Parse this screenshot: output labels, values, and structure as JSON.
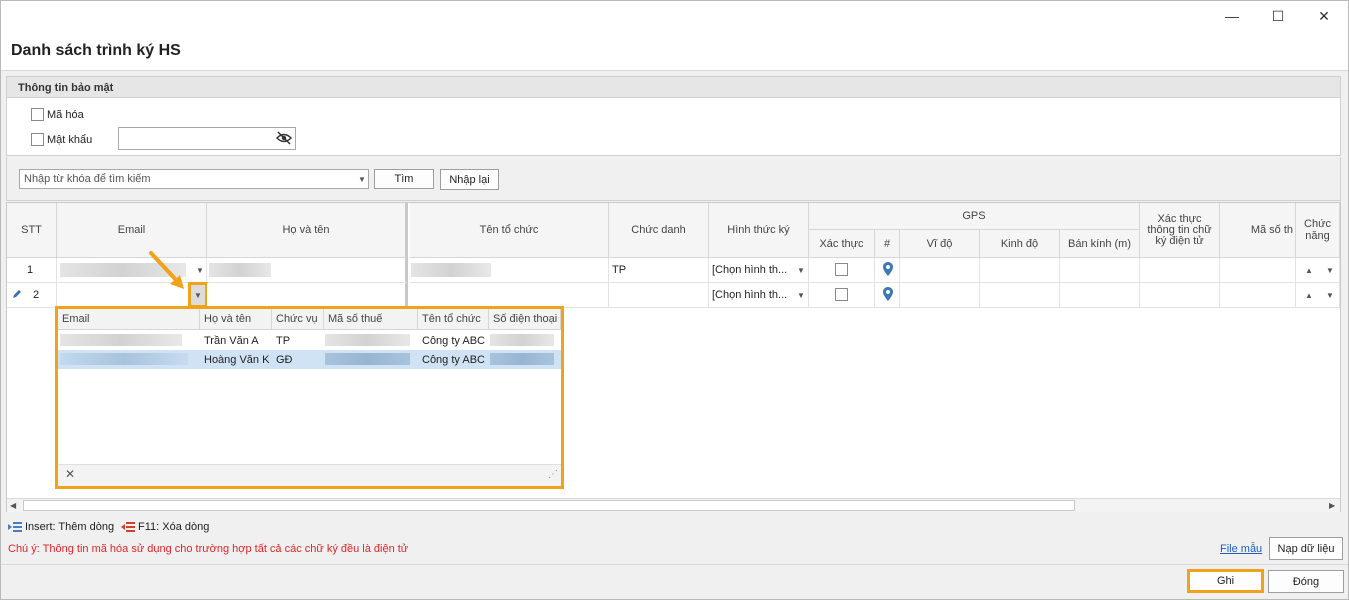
{
  "window": {
    "title": "Danh sách trình ký HS",
    "minimize_glyph": "—",
    "maximize_glyph": "☐",
    "close_glyph": "✕"
  },
  "security_panel": {
    "title": "Thông tin bảo mật",
    "encrypt_label": "Mã hóa",
    "password_label": "Mật khẩu",
    "password_value": "",
    "password_icon": "eye-slash-icon"
  },
  "search": {
    "placeholder": "Nhập từ khóa để tìm kiếm",
    "find_label": "Tìm",
    "reset_label": "Nhập lại"
  },
  "grid": {
    "headers": {
      "stt": "STT",
      "email": "Email",
      "full_name": "Họ và tên",
      "org_name": "Tên tổ chức",
      "position": "Chức danh",
      "sign_type": "Hình thức ký",
      "gps": "GPS",
      "verify": "Xác thực",
      "hash": "#",
      "latitude": "Vĩ độ",
      "longitude": "Kinh độ",
      "radius": "Bán kính (m)",
      "verify_sig": "Xác thực thông tin chữ ký điện tử",
      "tax_code": "Mã số th",
      "function": "Chức năng"
    },
    "rows": [
      {
        "stt": "1",
        "position": "TP",
        "sign_type": "[Chọn hình th..."
      },
      {
        "stt": "2",
        "position": "",
        "sign_type": "[Chọn hình th..."
      }
    ]
  },
  "popup": {
    "headers": [
      "Email",
      "Họ và tên",
      "Chức vụ",
      "Mã số thuế",
      "Tên tổ chức",
      "Số điện thoại"
    ],
    "rows": [
      {
        "full_name": "Trần Văn A",
        "position": "TP",
        "org": "Công ty ABC"
      },
      {
        "full_name": "Hoàng Văn K",
        "position": "GĐ",
        "org": "Công ty ABC"
      }
    ],
    "close_glyph": "✕",
    "resize_glyph": "⋰"
  },
  "hints": {
    "insert": "Insert: Thêm dòng",
    "f11": "F11: Xóa dòng",
    "note": "Chú ý: Thông tin mã hóa sử dụng cho trường hợp tất cả các chữ ký đều là điện tử"
  },
  "actions": {
    "template_link": "File mẫu",
    "load_data": "Nạp dữ liệu",
    "save": "Ghi",
    "close": "Đóng"
  },
  "colors": {
    "highlight": "#f0a21a",
    "note_red": "#e0242a",
    "link_blue": "#1f5fbf",
    "selected_row": "#cfe3f5",
    "pin_blue": "#3d78b8"
  }
}
